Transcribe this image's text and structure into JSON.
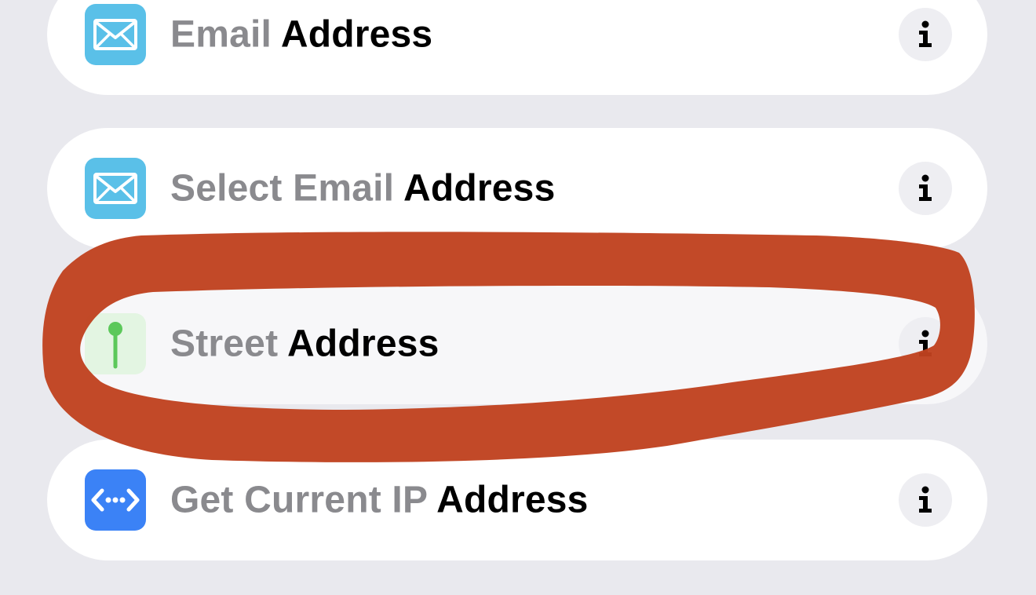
{
  "actions": [
    {
      "qualifier": "Email",
      "noun": "Address",
      "icon": "mail-icon",
      "icon_color": "#5ac0e8"
    },
    {
      "qualifier": "Select Email",
      "noun": "Address",
      "icon": "mail-icon",
      "icon_color": "#5ac0e8"
    },
    {
      "qualifier": "Street",
      "noun": "Address",
      "icon": "map-pin-icon",
      "icon_color": "#5cc85a"
    },
    {
      "qualifier": "Get Current IP",
      "noun": "Address",
      "icon": "network-icon",
      "icon_color": "#3b82f6"
    }
  ],
  "info_icon": "info-icon",
  "annotation": {
    "shape": "hand-drawn-ellipse",
    "color": "#c0421f",
    "target": "Street Address"
  }
}
